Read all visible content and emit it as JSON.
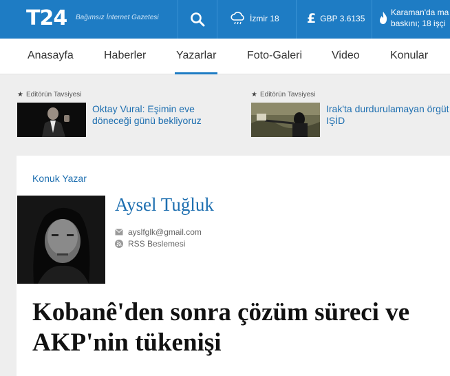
{
  "header": {
    "logo": "T24",
    "tagline": "Bağımsız İnternet Gazetesi",
    "weather_text": "İzmir 18",
    "currency_symbol": "£",
    "currency_text": "GBP 3.6135",
    "breaking_line1": "Karaman'da ma",
    "breaking_line2": "baskını; 18 işçi",
    "colors": {
      "brand": "#1e7cc4",
      "link": "#1e6fb0"
    }
  },
  "nav": {
    "items": [
      {
        "label": "Anasayfa"
      },
      {
        "label": "Haberler"
      },
      {
        "label": "Yazarlar"
      },
      {
        "label": "Foto-Galeri"
      },
      {
        "label": "Video"
      },
      {
        "label": "Konular"
      }
    ],
    "active": "Yazarlar"
  },
  "editor_picks": [
    {
      "label": "Editörün Tavsiyesi",
      "title_line1": "Oktay Vural: Eşimin eve",
      "title_line2": "döneceği günü bekliyoruz"
    },
    {
      "label": "Editörün Tavsiyesi",
      "title_line1": "Irak'ta durdurulamayan örgüt",
      "title_line2": "IŞİD"
    }
  ],
  "article": {
    "section_label": "Konuk Yazar",
    "author_name": "Aysel Tuğluk",
    "email": "ayslfglk@gmail.com",
    "rss_label": "RSS Beslemesi",
    "headline_line1": "Kobanê'den sonra çözüm süreci ve",
    "headline_line2": "AKP'nin tükenişi"
  }
}
